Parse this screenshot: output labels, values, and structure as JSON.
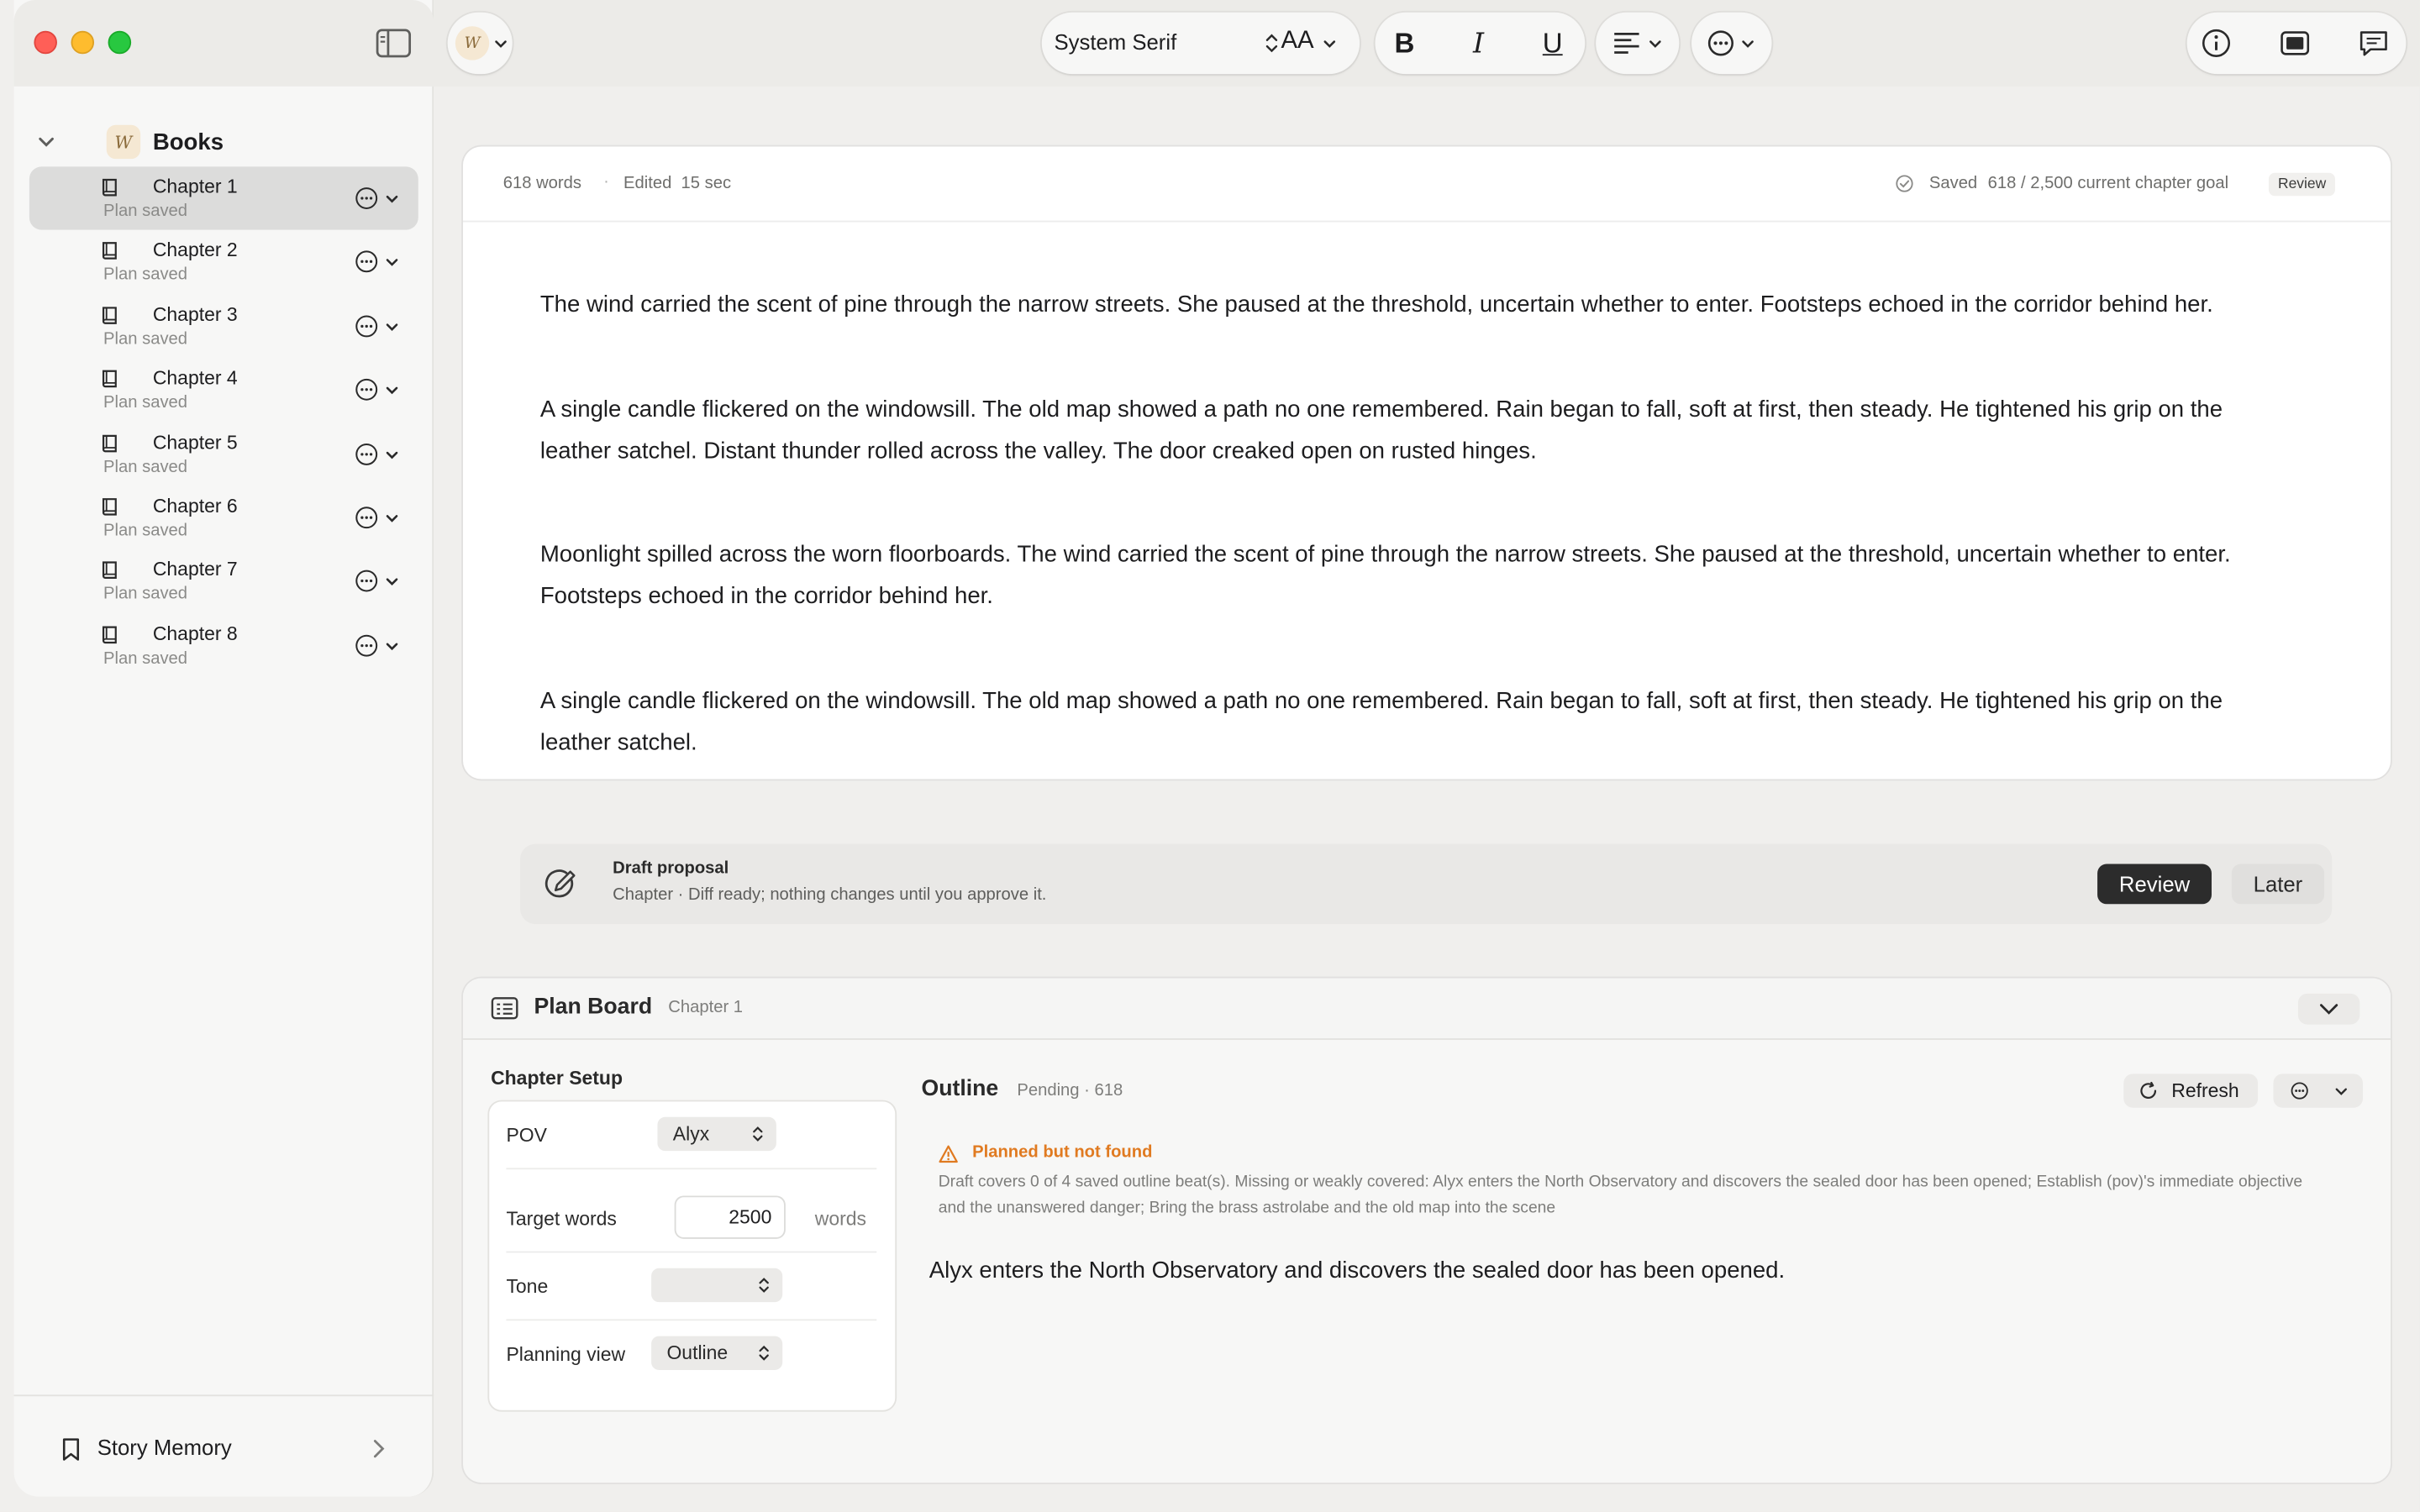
{
  "sidebar": {
    "root_label": "Books",
    "chapters": [
      {
        "title": "Chapter 1",
        "status": "Plan saved",
        "active": true
      },
      {
        "title": "Chapter 2",
        "status": "Plan saved"
      },
      {
        "title": "Chapter 3",
        "status": "Plan saved"
      },
      {
        "title": "Chapter 4",
        "status": "Plan saved"
      },
      {
        "title": "Chapter 5",
        "status": "Plan saved"
      },
      {
        "title": "Chapter 6",
        "status": "Plan saved"
      },
      {
        "title": "Chapter 7",
        "status": "Plan saved"
      },
      {
        "title": "Chapter 8",
        "status": "Plan saved"
      }
    ],
    "footer_label": "Story Memory"
  },
  "toolbar": {
    "font_name": "System Serif",
    "font_size_label": "AA",
    "bold_label": "B",
    "italic_label": "I",
    "underline_label": "U"
  },
  "editor": {
    "word_count": "618 words",
    "separator": "·",
    "edited_label": "Edited  15 sec",
    "saved_label": "Saved",
    "goal_label": "618 / 2,500 current chapter goal",
    "review_tag": "Review",
    "paragraphs": [
      "The wind carried the scent of pine through the narrow streets. She paused at the threshold, uncertain whether to enter. Footsteps echoed in the corridor behind her.",
      "A single candle flickered on the windowsill. The old map showed a path no one remembered. Rain began to fall, soft at first, then steady. He tightened his grip on the leather satchel. Distant thunder rolled across the valley. The door creaked open on rusted hinges.",
      "Moonlight spilled across the worn floorboards. The wind carried the scent of pine through the narrow streets. She paused at the threshold, uncertain whether to enter. Footsteps echoed in the corridor behind her.",
      "A single candle flickered on the windowsill. The old map showed a path no one remembered. Rain began to fall, soft at first, then steady. He tightened his grip on the leather satchel."
    ]
  },
  "proposal": {
    "title": "Draft proposal",
    "description": "Chapter · Diff ready; nothing changes until you approve it.",
    "review_label": "Review",
    "later_label": "Later"
  },
  "plan_board": {
    "title": "Plan Board",
    "subtitle": "Chapter 1",
    "setup": {
      "title": "Chapter Setup",
      "pov_label": "POV",
      "pov_value": "Alyx",
      "target_label": "Target words",
      "target_value": "2500",
      "target_unit": "words",
      "tone_label": "Tone",
      "tone_value": "",
      "view_label": "Planning view",
      "view_value": "Outline"
    },
    "outline": {
      "title": "Outline",
      "status": "Pending · 618",
      "refresh_label": "Refresh",
      "warning_title": "Planned but not found",
      "warning_desc": "Draft covers 0 of 4 saved outline beat(s). Missing or weakly covered: Alyx enters the North Observatory and discovers the sealed door has been opened; Establish (pov)'s immediate objective and the unanswered danger; Bring the brass astrolabe and the old map into the scene",
      "beat": "Alyx enters the North Observatory and discovers the sealed door has been opened."
    }
  },
  "colors": {
    "accent_warning": "#e07a20",
    "primary_button": "#2c2c2c"
  }
}
